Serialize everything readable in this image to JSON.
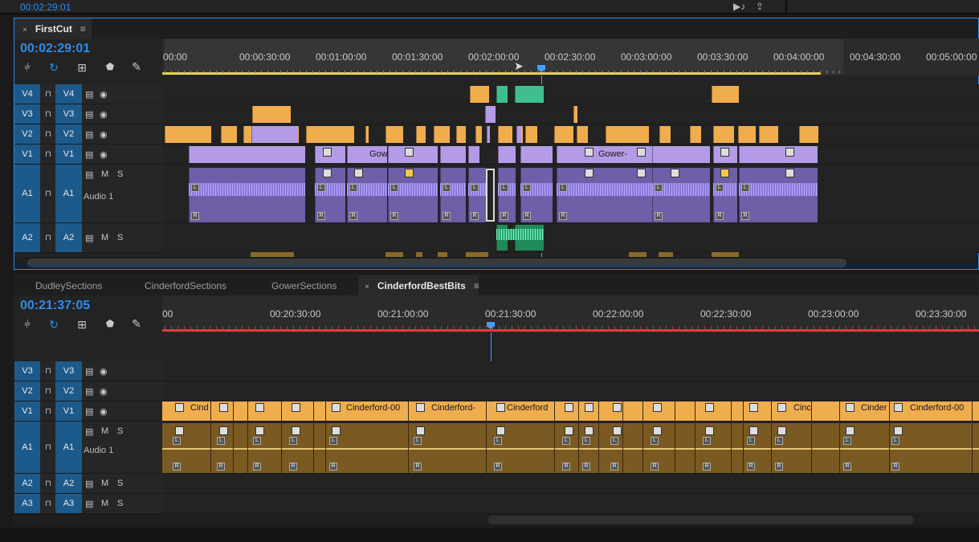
{
  "app": {
    "top_timecode": "00:02:29:01"
  },
  "colors": {
    "accent": "#2d8ceb",
    "video_purple": "#b49be7",
    "video_orange": "#f0ad4e",
    "audio_green": "#3fbf8f",
    "nested_orange": "#7a5a22",
    "playhead": "#41a1ff",
    "inout_red": "#e03a3a"
  },
  "top_panel": {
    "tab": {
      "close": "×",
      "label": "FirstCut",
      "menu": "≡"
    },
    "timecode": "00:02:29:01",
    "ruler_ticks": [
      "00:00",
      "00:00:30:00",
      "00:01:00:00",
      "00:01:30:00",
      "00:02:00:00",
      "00:02:30:00",
      "00:03:00:00",
      "00:03:30:00",
      "00:04:00:00",
      "00:04:30:00",
      "00:05:00:00"
    ],
    "tracks": [
      {
        "target": "V4",
        "source": "V4",
        "type": "video"
      },
      {
        "target": "V3",
        "source": "V3",
        "type": "video"
      },
      {
        "target": "V2",
        "source": "V2",
        "type": "video"
      },
      {
        "target": "V1",
        "source": "V1",
        "type": "video"
      },
      {
        "target": "A1",
        "source": "A1",
        "type": "audio",
        "name": "Audio 1",
        "m": "M",
        "s": "S"
      },
      {
        "target": "A2",
        "source": "A2",
        "type": "audio",
        "m": "M",
        "s": "S"
      }
    ],
    "clip_labels": [
      "Gow",
      "Gower-"
    ]
  },
  "bottom_panel": {
    "tabs": [
      {
        "label": "DudleySections"
      },
      {
        "label": "CinderfordSections"
      },
      {
        "label": "GowerSections"
      },
      {
        "label": "CinderfordBestBits",
        "close": "×",
        "menu": "≡"
      }
    ],
    "timecode": "00:21:37:05",
    "ruler_ticks": [
      "00",
      "00:20:30:00",
      "00:21:00:00",
      "00:21:30:00",
      "00:22:00:00",
      "00:22:30:00",
      "00:23:00:00",
      "00:23:30:00"
    ],
    "tracks": [
      {
        "target": "V3",
        "source": "V3",
        "type": "video"
      },
      {
        "target": "V2",
        "source": "V2",
        "type": "video"
      },
      {
        "target": "V1",
        "source": "V1",
        "type": "video"
      },
      {
        "target": "A1",
        "source": "A1",
        "type": "audio",
        "name": "Audio 1",
        "m": "M",
        "s": "S"
      },
      {
        "target": "A2",
        "source": "A2",
        "type": "audio",
        "m": "M",
        "s": "S"
      },
      {
        "target": "A3",
        "source": "A3",
        "type": "audio",
        "m": "M",
        "s": "S"
      }
    ],
    "clip_labels": [
      "Cind",
      "Cinderford-00",
      "Cinderford-",
      "Cinderford",
      "Cinc",
      "Cinder",
      "Cinderford-00"
    ]
  },
  "icons": [
    "snap-icon",
    "linked-selection-icon",
    "add-marker-icon",
    "marker-icon",
    "wrench-icon",
    "lock-icon",
    "toggle-output-icon",
    "eye-icon",
    "export-frame-icon",
    "settings-export-icon"
  ]
}
